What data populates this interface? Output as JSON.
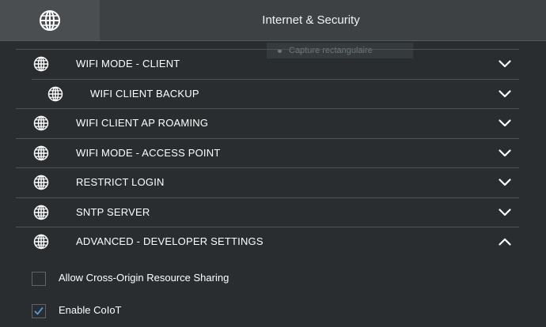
{
  "header": {
    "title": "Internet & Security",
    "icon": "globe-icon"
  },
  "overlay": {
    "label": "Capture rectangulaire"
  },
  "sections": [
    {
      "label": "WIFI MODE - CLIENT",
      "expanded": false,
      "icon": "globe-icon"
    },
    {
      "label": "WIFI CLIENT BACKUP",
      "expanded": false,
      "icon": "globe-icon",
      "sub": true
    },
    {
      "label": "WIFI CLIENT AP ROAMING",
      "expanded": false,
      "icon": "globe-icon"
    },
    {
      "label": "WIFI MODE - ACCESS POINT",
      "expanded": false,
      "icon": "globe-icon"
    },
    {
      "label": "RESTRICT LOGIN",
      "expanded": false,
      "icon": "globe-icon"
    },
    {
      "label": "SNTP SERVER",
      "expanded": false,
      "icon": "globe-icon"
    },
    {
      "label": "ADVANCED - DEVELOPER SETTINGS",
      "expanded": true,
      "icon": "globe-icon"
    }
  ],
  "advanced": {
    "options": [
      {
        "label": "Allow Cross-Origin Resource Sharing",
        "checked": false
      },
      {
        "label": "Enable CoIoT",
        "checked": true
      }
    ]
  },
  "colors": {
    "background": "#2a2d2f",
    "header": "#3d4143",
    "check": "#4fa3e0"
  }
}
